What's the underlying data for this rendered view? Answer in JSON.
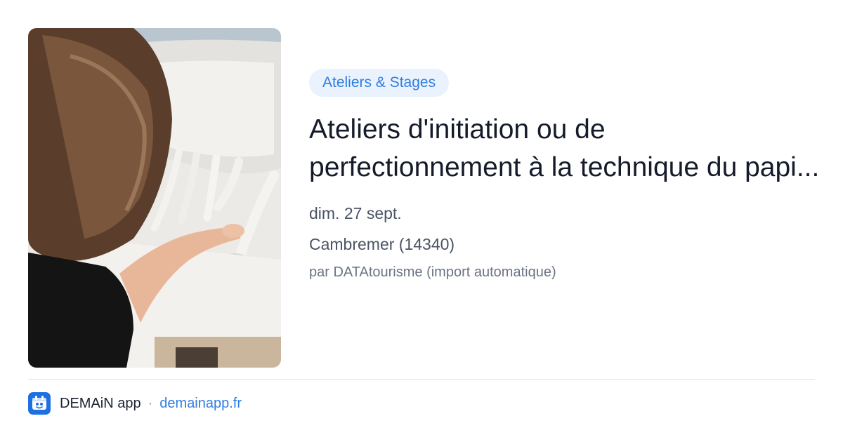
{
  "event": {
    "category": "Ateliers & Stages",
    "title": "Ateliers d'initiation ou de perfectionnement à la technique du papi...",
    "date": "dim. 27 sept.",
    "location": "Cambremer (14340)",
    "source": "par DATAtourisme (import automatique)"
  },
  "footer": {
    "app_name": "DEMAiN app",
    "separator": "·",
    "url": "demainapp.fr"
  },
  "colors": {
    "accent": "#2f7de1",
    "pill_background": "#eaf2fe",
    "title_text": "#151b2a",
    "logo_background": "#1e6fe0"
  },
  "icons": {
    "app_logo": "demain-logo-icon"
  }
}
